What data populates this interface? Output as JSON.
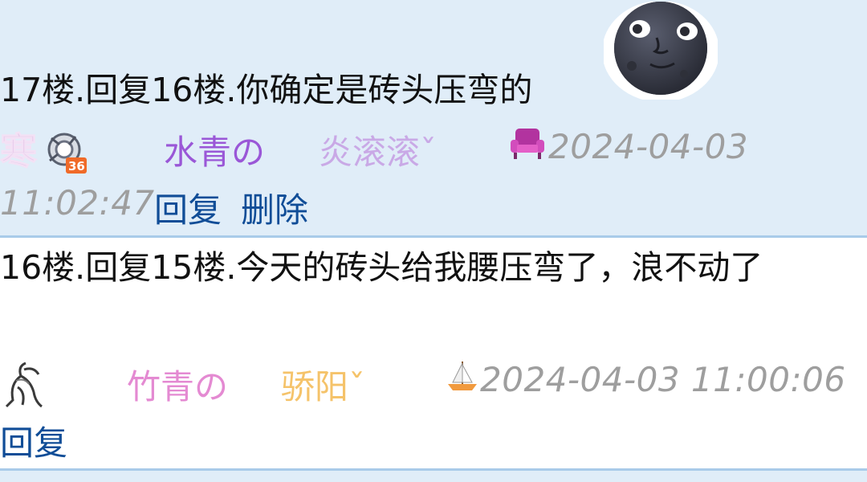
{
  "posts": [
    {
      "floor_text": "17楼.回复16楼.你确定是砖头压弯的",
      "user": {
        "prefix": "水青の",
        "name": "炎滚滚ˇ"
      },
      "time_part1": "2024-04-03",
      "time_part2": "11:02:47",
      "reply_label": "回复",
      "delete_label": "删除",
      "emoji": "moon-face-icon",
      "badge_icon": "armchair-icon"
    },
    {
      "floor_text": "16楼.回复15楼.今天的砖头给我腰压弯了，浪不动了",
      "user": {
        "prefix": "竹青の",
        "name": "骄阳ˇ"
      },
      "time": "2024-04-03 11:00:06",
      "reply_label": "回复",
      "badge_icon": "sailboat-icon"
    }
  ],
  "colors": {
    "post_bg_alt": "#e0edf8",
    "divider": "#a9cbe9",
    "link": "#104d97",
    "time": "#9e9e9e"
  }
}
